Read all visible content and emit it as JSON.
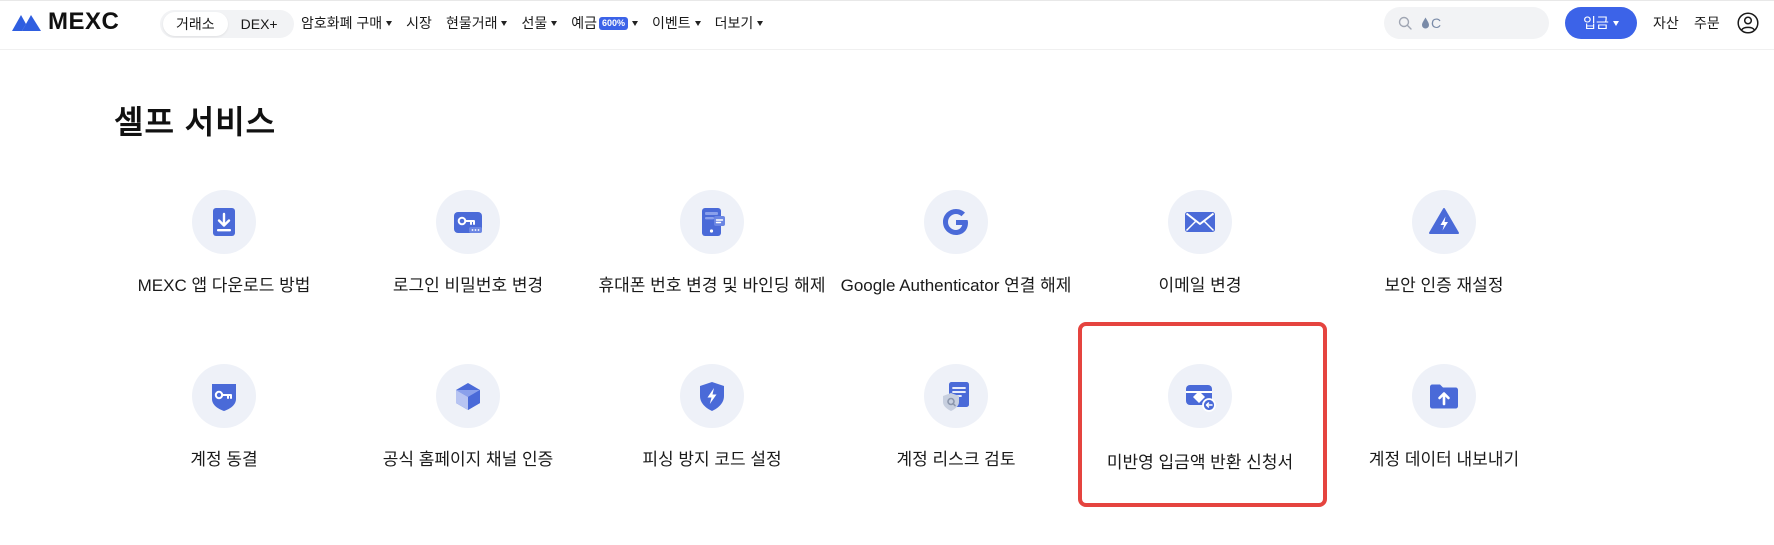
{
  "header": {
    "logo_text": "MEXC",
    "segment": {
      "exchange_label": "거래소",
      "dex_label": "DEX+"
    },
    "nav": [
      {
        "label": "암호화폐 구매",
        "has_caret": true
      },
      {
        "label": "시장",
        "has_caret": false
      },
      {
        "label": "현물거래",
        "has_caret": true
      },
      {
        "label": "선물",
        "has_caret": true
      },
      {
        "label": "예금",
        "badge": "600%",
        "has_caret": true
      },
      {
        "label": "이벤트",
        "has_caret": true
      },
      {
        "label": "더보기",
        "has_caret": true
      }
    ],
    "search": {
      "value": "C",
      "placeholder": ""
    },
    "deposit_label": "입금",
    "assets_label": "자산",
    "orders_label": "주문"
  },
  "page": {
    "title": "셀프 서비스",
    "services": [
      {
        "label": "MEXC 앱 다운로드 방법",
        "icon": "download-icon"
      },
      {
        "label": "로그인 비밀번호 변경",
        "icon": "password-key-icon"
      },
      {
        "label": "휴대폰 번호 변경 및 바인딩 해제",
        "icon": "phone-icon"
      },
      {
        "label": "Google Authenticator 연결 해제",
        "icon": "google-icon"
      },
      {
        "label": "이메일 변경",
        "icon": "email-icon"
      },
      {
        "label": "보안 인증 재설정",
        "icon": "security-warning-icon"
      },
      {
        "label": "계정 동결",
        "icon": "account-freeze-icon"
      },
      {
        "label": "공식 홈페이지 채널 인증",
        "icon": "verify-cube-icon"
      },
      {
        "label": "피싱 방지 코드 설정",
        "icon": "shield-bolt-icon"
      },
      {
        "label": "계정 리스크 검토",
        "icon": "risk-review-icon"
      },
      {
        "label": "미반영 입금액 반환 신청서",
        "icon": "deposit-return-icon",
        "highlighted": true
      },
      {
        "label": "계정 데이터 내보내기",
        "icon": "folder-upload-icon"
      }
    ]
  },
  "colors": {
    "brand_blue": "#3c63e8",
    "icon_blue": "#4a6ad8",
    "highlight_red": "#e5443f",
    "icon_bg": "#eef1f8"
  }
}
